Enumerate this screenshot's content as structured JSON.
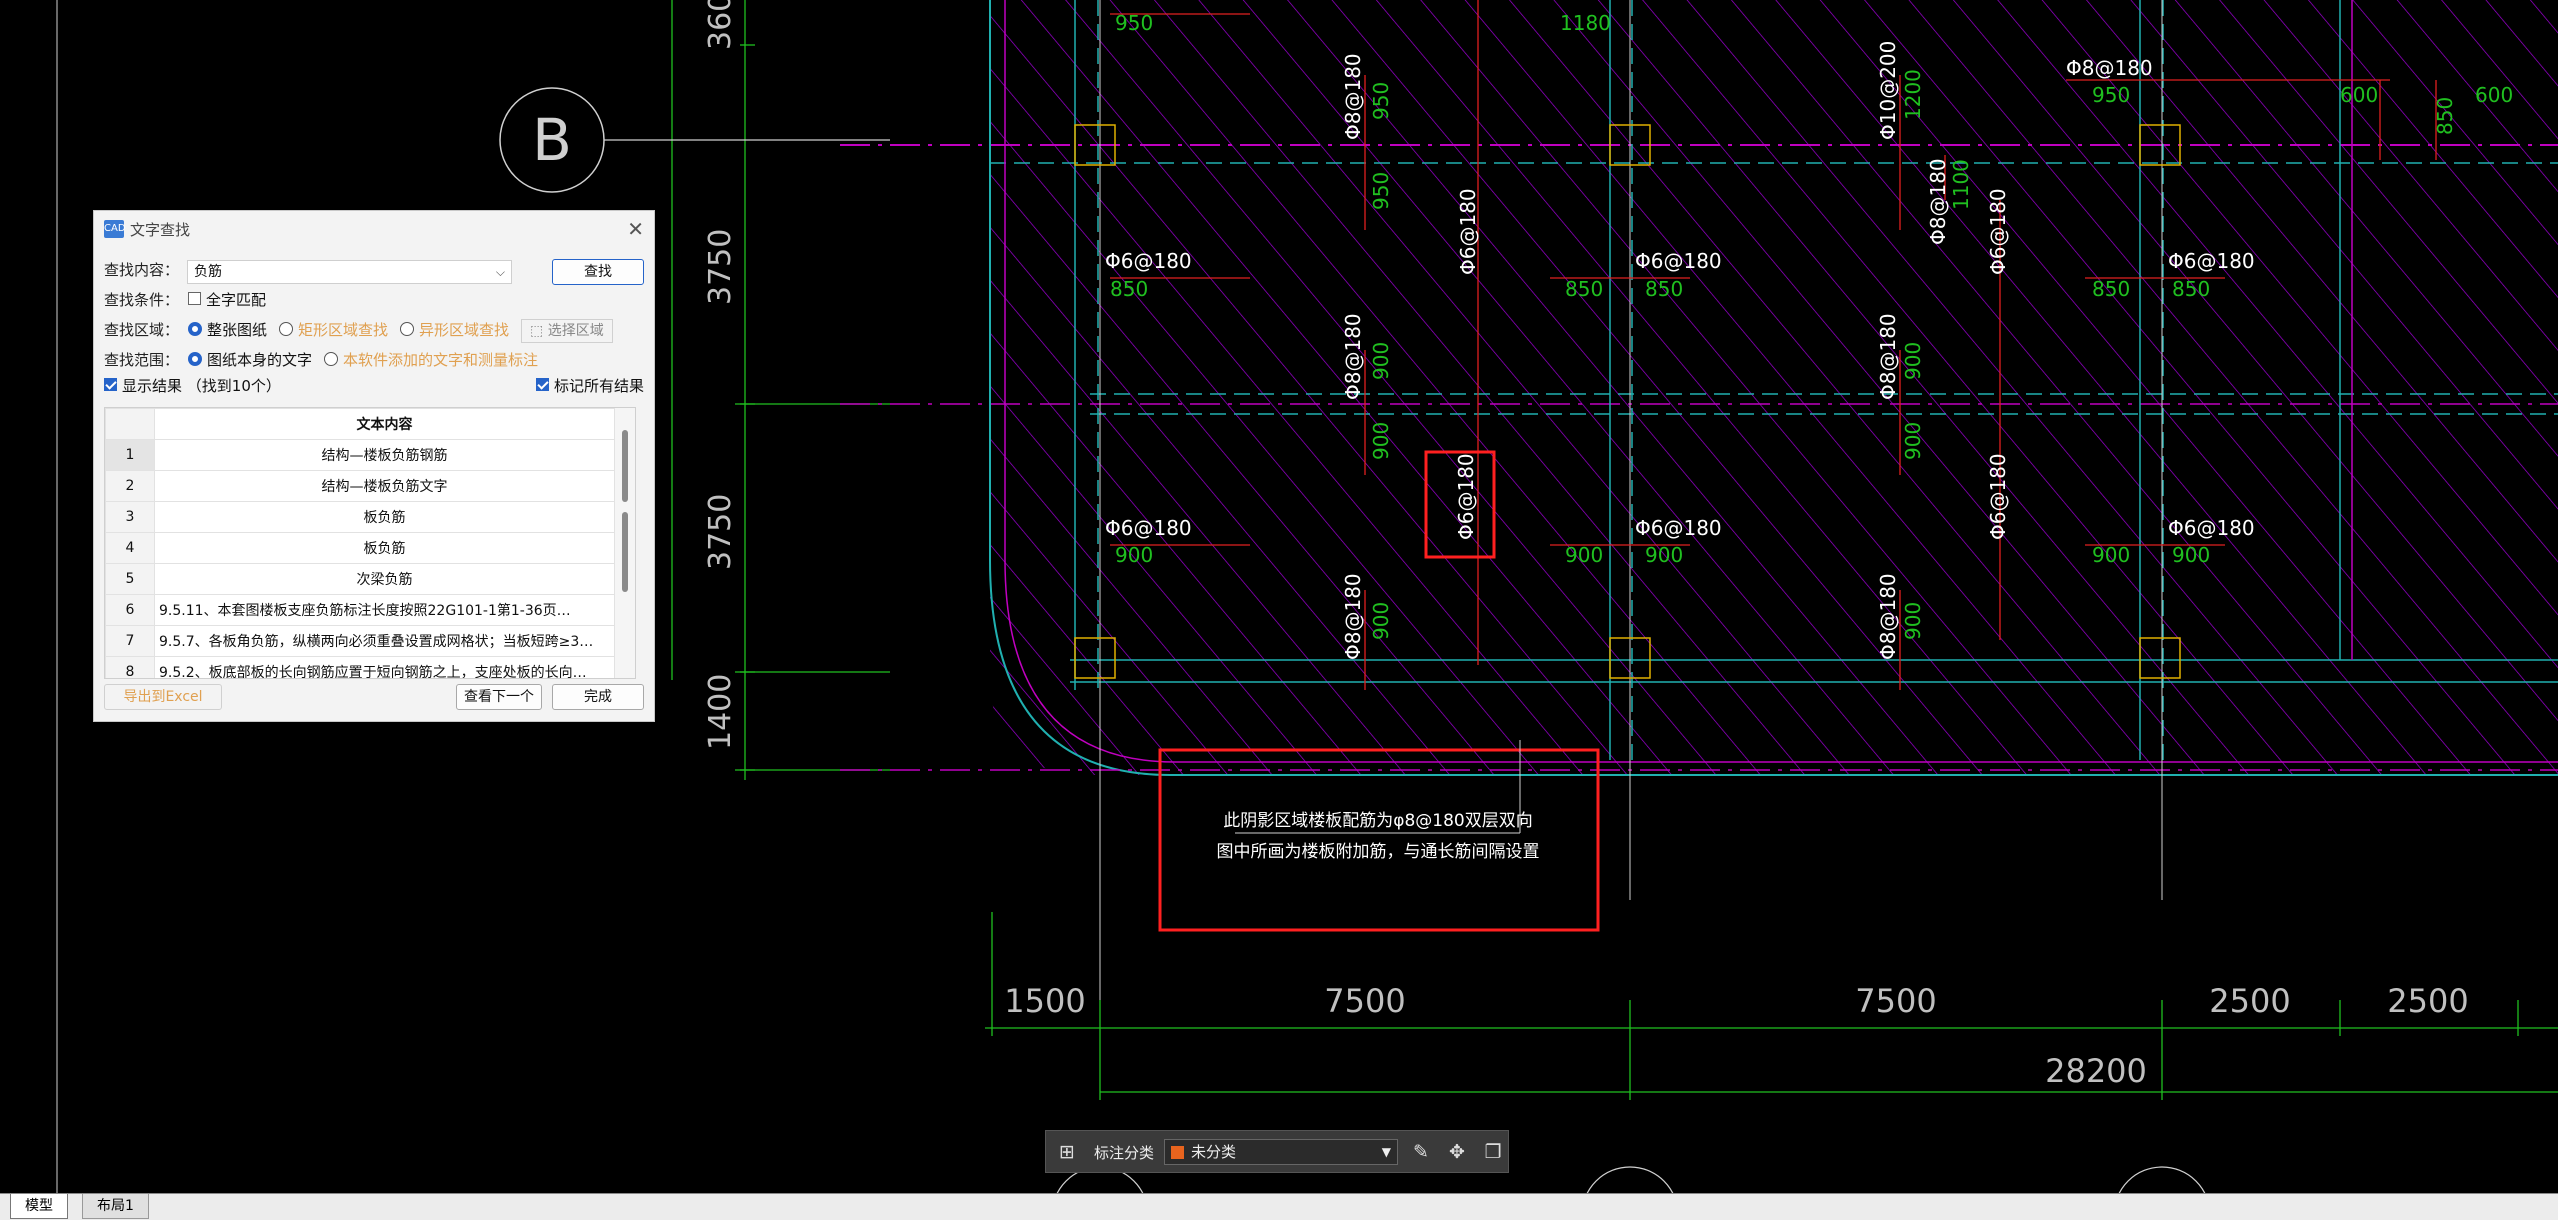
{
  "drawing": {
    "axis_bubble": "B",
    "left_dims": [
      "360",
      "3750",
      "3750",
      "1400"
    ],
    "bottom_dims": [
      "1500",
      "7500",
      "7500",
      "2500",
      "2500"
    ],
    "total_dim": "28200",
    "note_line1": "此阴影区域楼板配筋为φ8@180双层双向",
    "note_line2": "图中所画为楼板附加筋，与通长筋间隔设置",
    "rebar": {
      "p6_180": "Φ6@180",
      "p8_180": "Φ8@180",
      "p10_200": "Φ10@200",
      "v950": "950",
      "v1180": "1180",
      "v1200": "1200",
      "v600": "600",
      "v850": "850",
      "v900": "900",
      "v1100": "1100"
    },
    "colors": {
      "background": "#000000",
      "hatch": "#a000d8",
      "rebar_red": "#e02020",
      "dim_green": "#20c020",
      "axis": "#c0c0c0",
      "highlight": "#ff2020",
      "grid_cyan": "#20b0b0"
    }
  },
  "dialog": {
    "title": "文字查找",
    "app_icon": "CAD",
    "close_icon": "close-icon",
    "find_content_label": "查找内容：",
    "find_content_value": "负筋",
    "find_button": "查找",
    "condition_label": "查找条件：",
    "whole_word": "全字匹配",
    "area_label": "查找区域：",
    "area_options": [
      "整张图纸",
      "矩形区域查找",
      "异形区域查找"
    ],
    "select_area": "选择区域",
    "range_label": "查找范围：",
    "range_options": [
      "图纸本身的文字",
      "本软件添加的文字和测量标注"
    ],
    "show_results": "显示结果",
    "found_count": "（找到10个）",
    "mark_all": "标记所有结果",
    "table_header": "文本内容",
    "rows": [
      {
        "idx": "1",
        "text": "结构—楼板负筋钢筋"
      },
      {
        "idx": "2",
        "text": "结构—楼板负筋文字"
      },
      {
        "idx": "3",
        "text": "板负筋"
      },
      {
        "idx": "4",
        "text": "板负筋"
      },
      {
        "idx": "5",
        "text": "次梁负筋"
      },
      {
        "idx": "6",
        "text": "9.5.11、本套图楼板支座负筋标注长度按照22G101-1第1-36页…"
      },
      {
        "idx": "7",
        "text": "9.5.7、各板角负筋，纵横两向必须重叠设置成网格状；当板短跨≥3…"
      },
      {
        "idx": "8",
        "text": "9.5.2、板底部板的长向钢筋应置于短向钢筋之上，支座处板的长向…"
      }
    ],
    "export_button": "导出到Excel",
    "next_button": "查看下一个",
    "done_button": "完成"
  },
  "annotation_bar": {
    "label": "标注分类",
    "selected": "未分类",
    "swatch_color": "#e8641e"
  },
  "tabs": [
    "模型",
    "布局1"
  ]
}
